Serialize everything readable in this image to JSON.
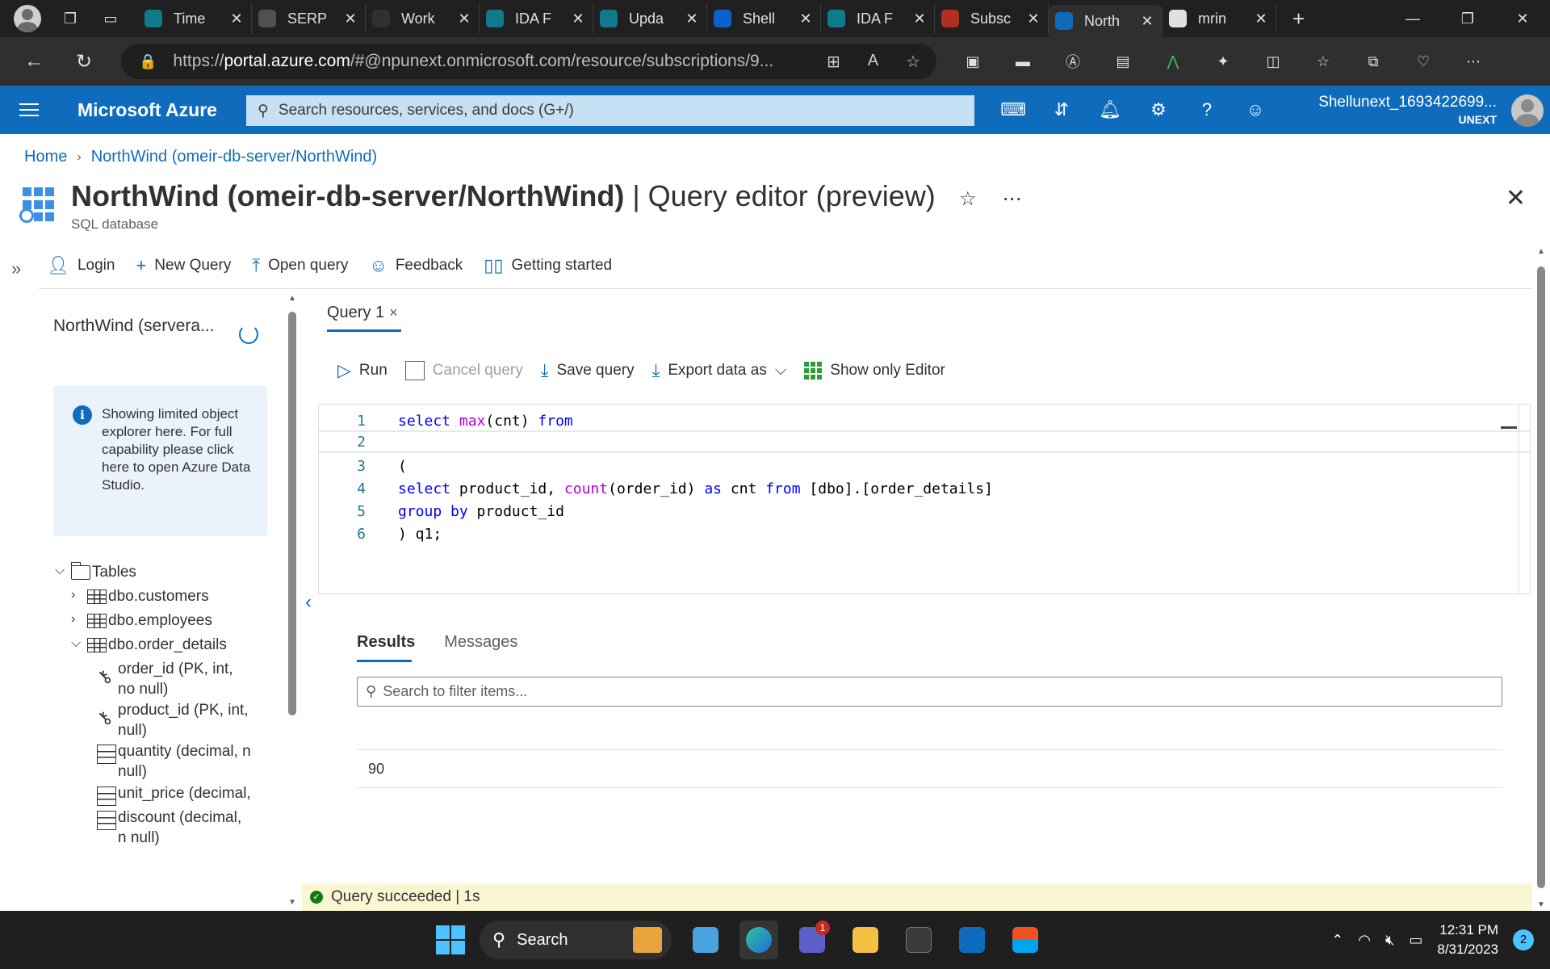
{
  "browser": {
    "tabs": [
      {
        "label": "Time",
        "favicon_color": "#0e7a8a"
      },
      {
        "label": "SERP",
        "favicon_color": "#505050"
      },
      {
        "label": "Work",
        "favicon_color": "#303030"
      },
      {
        "label": "IDA F",
        "favicon_color": "#0e7a8a"
      },
      {
        "label": "Upda",
        "favicon_color": "#0e7a8a"
      },
      {
        "label": "Shell",
        "favicon_color": "#0a64c8"
      },
      {
        "label": "IDA F",
        "favicon_color": "#0e7a8a"
      },
      {
        "label": "Subsc",
        "favicon_color": "#b03020"
      },
      {
        "label": "North",
        "favicon_color": "#0f6cbd"
      },
      {
        "label": "mrin",
        "favicon_color": "#e0e0e0"
      }
    ],
    "url_prefix": "https://",
    "url_domain": "portal.azure.com",
    "url_rest": "/#@npunext.onmicrosoft.com/resource/subscriptions/9..."
  },
  "azure": {
    "brand": "Microsoft Azure",
    "search_placeholder": "Search resources, services, and docs (G+/)",
    "account_name": "Shellunext_1693422699...",
    "account_tenant": "UNEXT"
  },
  "breadcrumb": {
    "home": "Home",
    "current": "NorthWind (omeir-db-server/NorthWind)"
  },
  "page": {
    "title_bold": "NorthWind (omeir-db-server/NorthWind)",
    "title_rest": " | Query editor (preview)",
    "subtitle": "SQL database"
  },
  "commands": {
    "login": "Login",
    "new_query": "New Query",
    "open_query": "Open query",
    "feedback": "Feedback",
    "getting_started": "Getting started"
  },
  "explorer": {
    "db_label": "NorthWind (servera...",
    "info": "Showing limited object explorer here. For full capability please click here to open Azure Data Studio.",
    "tables_label": "Tables",
    "tables": [
      "dbo.customers",
      "dbo.employees",
      "dbo.order_details"
    ],
    "columns": [
      "order_id (PK, int, no null)",
      "product_id (PK, int, null)",
      "quantity (decimal, n null)",
      "unit_price (decimal,",
      "discount (decimal, n null)"
    ]
  },
  "editor": {
    "tab_label": "Query 1",
    "toolbar": {
      "run": "Run",
      "cancel": "Cancel query",
      "save": "Save query",
      "export": "Export data as",
      "show_only": "Show only Editor"
    },
    "line_numbers": [
      "1",
      "2",
      "3",
      "4",
      "5",
      "6"
    ]
  },
  "results": {
    "tab_results": "Results",
    "tab_messages": "Messages",
    "filter_placeholder": "Search to filter items...",
    "value": "90",
    "status": "Query succeeded | 1s"
  },
  "taskbar": {
    "search": "Search",
    "time": "12:31 PM",
    "date": "8/31/2023",
    "notifications": "2",
    "teams_badge": "1"
  }
}
